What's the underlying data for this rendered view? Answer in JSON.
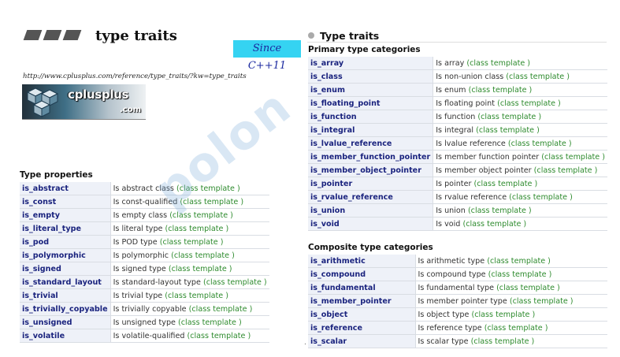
{
  "header": {
    "title": "type traits",
    "since": "Since C++11",
    "url": "http://www.cplusplus.com/reference/type_traits/?kw=type_traits"
  },
  "logo": {
    "name": "cplusplus",
    "domain": ".com"
  },
  "watermark": "polon",
  "colors": {
    "since_bg": "#35d3f2",
    "name_text": "#1a237e",
    "kind_text": "#2e8b2e",
    "name_bg": "#eef1f8"
  },
  "left": {
    "heading": "Type properties",
    "rows": [
      {
        "name": "is_abstract",
        "desc": "Is abstract class",
        "kind": "(class template )"
      },
      {
        "name": "is_const",
        "desc": "Is const-qualified",
        "kind": "(class template )"
      },
      {
        "name": "is_empty",
        "desc": "Is empty class",
        "kind": "(class template )"
      },
      {
        "name": "is_literal_type",
        "desc": "Is literal type",
        "kind": "(class template )"
      },
      {
        "name": "is_pod",
        "desc": "Is POD type",
        "kind": "(class template )"
      },
      {
        "name": "is_polymorphic",
        "desc": "Is polymorphic",
        "kind": "(class template )"
      },
      {
        "name": "is_signed",
        "desc": "Is signed type",
        "kind": "(class template )"
      },
      {
        "name": "is_standard_layout",
        "desc": "Is standard-layout type",
        "kind": "(class template )"
      },
      {
        "name": "is_trivial",
        "desc": "Is trivial type",
        "kind": "(class template )"
      },
      {
        "name": "is_trivially_copyable",
        "desc": "Is trivially copyable",
        "kind": "(class template )"
      },
      {
        "name": "is_unsigned",
        "desc": "Is unsigned type",
        "kind": "(class template )"
      },
      {
        "name": "is_volatile",
        "desc": "Is volatile-qualified",
        "kind": "(class template )"
      }
    ]
  },
  "right": {
    "title": "Type traits",
    "primary": {
      "heading": "Primary type categories",
      "rows": [
        {
          "name": "is_array",
          "desc": "Is array",
          "kind": "(class template )"
        },
        {
          "name": "is_class",
          "desc": "Is non-union class",
          "kind": "(class template )"
        },
        {
          "name": "is_enum",
          "desc": "Is enum",
          "kind": "(class template )"
        },
        {
          "name": "is_floating_point",
          "desc": "Is floating point",
          "kind": "(class template )"
        },
        {
          "name": "is_function",
          "desc": "Is function",
          "kind": "(class template )"
        },
        {
          "name": "is_integral",
          "desc": "Is integral",
          "kind": "(class template )"
        },
        {
          "name": "is_lvalue_reference",
          "desc": "Is lvalue reference",
          "kind": "(class template )"
        },
        {
          "name": "is_member_function_pointer",
          "desc": "Is member function pointer",
          "kind": "(class template )"
        },
        {
          "name": "is_member_object_pointer",
          "desc": "Is member object pointer",
          "kind": "(class template )"
        },
        {
          "name": "is_pointer",
          "desc": "Is pointer",
          "kind": "(class template )"
        },
        {
          "name": "is_rvalue_reference",
          "desc": "Is rvalue reference",
          "kind": "(class template )"
        },
        {
          "name": "is_union",
          "desc": "Is union",
          "kind": "(class template )"
        },
        {
          "name": "is_void",
          "desc": "Is void",
          "kind": "(class template )"
        }
      ]
    },
    "composite": {
      "heading": "Composite type categories",
      "rows": [
        {
          "name": "is_arithmetic",
          "desc": "Is arithmetic type",
          "kind": "(class template )"
        },
        {
          "name": "is_compound",
          "desc": "Is compound type",
          "kind": "(class template )"
        },
        {
          "name": "is_fundamental",
          "desc": "Is fundamental type",
          "kind": "(class template )"
        },
        {
          "name": "is_member_pointer",
          "desc": "Is member pointer type",
          "kind": "(class template )"
        },
        {
          "name": "is_object",
          "desc": "Is object type",
          "kind": "(class template )"
        },
        {
          "name": "is_reference",
          "desc": "Is reference type",
          "kind": "(class template )"
        },
        {
          "name": "is_scalar",
          "desc": "Is scalar type",
          "kind": "(class template )"
        }
      ]
    }
  }
}
